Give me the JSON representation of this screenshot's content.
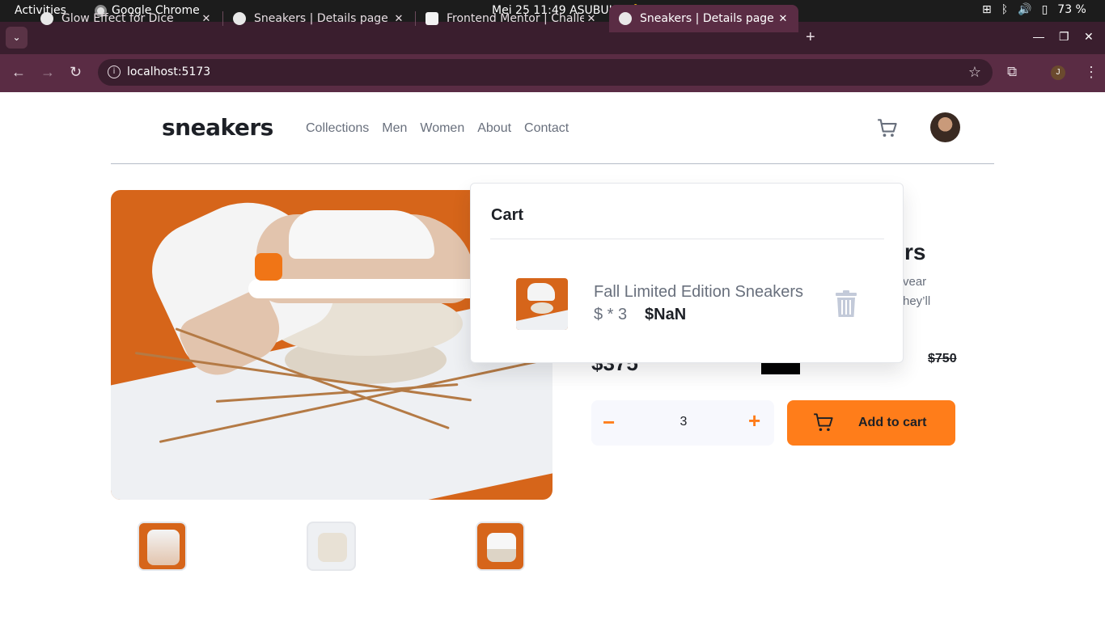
{
  "system_bar": {
    "activities": "Activities",
    "app_name": "Google Chrome",
    "clock": "Mei 25  11:49 ASUBUHI",
    "battery": "73 %"
  },
  "browser": {
    "tabs": [
      {
        "title": "Glow Effect for Dice",
        "active": false
      },
      {
        "title": "Sneakers | Details page",
        "active": false
      },
      {
        "title": "Frontend Mentor | Challe",
        "active": false
      },
      {
        "title": "Sneakers | Details page",
        "active": true
      }
    ],
    "url": "localhost:5173",
    "profile_initial": "J"
  },
  "site": {
    "logo": "sneakers",
    "nav": [
      "Collections",
      "Men",
      "Women",
      "About",
      "Contact"
    ]
  },
  "product": {
    "title_tail": "rs",
    "desc_tail_1": "vear",
    "desc_tail_2": "hey’ll",
    "price_now": "$375",
    "price_old": "$750",
    "quantity": "3",
    "add_to_cart_label": "Add to cart"
  },
  "cart": {
    "title": "Cart",
    "item_name": "Fall Limited Edition Sneakers",
    "item_qty": "$ * 3",
    "item_total": "$NaN"
  },
  "colors": {
    "accent": "#ff7d1a",
    "dark": "#1d2026",
    "grey": "#69707d",
    "chrome_tabstrip": "#3a1e2e",
    "chrome_toolbar": "#5a2c44"
  }
}
